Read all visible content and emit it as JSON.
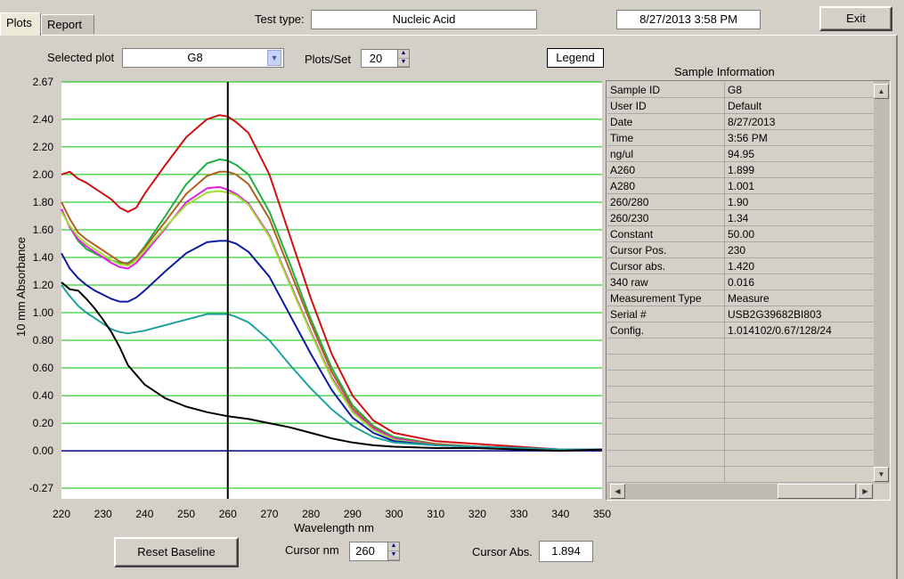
{
  "tabs": {
    "plots": "Plots",
    "report": "Report"
  },
  "header": {
    "test_type_label": "Test type:",
    "test_type_value": "Nucleic Acid",
    "datetime": "8/27/2013  3:58 PM",
    "exit_label": "Exit"
  },
  "controls": {
    "selected_plot_label": "Selected plot",
    "selected_plot_value": "G8",
    "plots_per_set_label": "Plots/Set",
    "plots_per_set_value": "20",
    "legend_label": "Legend",
    "reset_baseline_label": "Reset Baseline",
    "cursor_nm_label": "Cursor nm",
    "cursor_nm_value": "260",
    "cursor_abs_label": "Cursor Abs.",
    "cursor_abs_value": "1.894"
  },
  "sample_info": {
    "title": "Sample Information",
    "rows": [
      [
        "Sample ID",
        "G8"
      ],
      [
        "User ID",
        "Default"
      ],
      [
        "Date",
        "8/27/2013"
      ],
      [
        "Time",
        "3:56 PM"
      ],
      [
        "ng/ul",
        " 94.95"
      ],
      [
        "A260",
        " 1.899"
      ],
      [
        "A280",
        " 1.001"
      ],
      [
        "260/280",
        "  1.90"
      ],
      [
        "260/230",
        "  1.34"
      ],
      [
        "Constant",
        " 50.00"
      ],
      [
        "Cursor Pos.",
        " 230"
      ],
      [
        "Cursor abs.",
        " 1.420"
      ],
      [
        "340 raw",
        " 0.016"
      ],
      [
        "Measurement Type",
        "Measure"
      ],
      [
        "Serial #",
        "USB2G39682BI803"
      ],
      [
        "Config.",
        "1.014102/0.67/128/24"
      ],
      [
        "",
        ""
      ],
      [
        "",
        ""
      ],
      [
        "",
        ""
      ],
      [
        "",
        ""
      ],
      [
        "",
        ""
      ],
      [
        "",
        ""
      ],
      [
        "",
        ""
      ],
      [
        "",
        ""
      ],
      [
        "",
        ""
      ]
    ]
  },
  "chart_data": {
    "type": "line",
    "xlabel": "Wavelength nm",
    "ylabel": "10 mm Absorbance",
    "xlim": [
      220,
      350
    ],
    "ylim": [
      -0.27,
      2.67
    ],
    "x_ticks": [
      "220",
      "230",
      "240",
      "250",
      "260",
      "270",
      "280",
      "290",
      "300",
      "310",
      "320",
      "330",
      "340",
      "350"
    ],
    "y_ticks": [
      "2.67",
      "2.40",
      "2.20",
      "2.00",
      "1.80",
      "1.60",
      "1.40",
      "1.20",
      "1.00",
      "0.80",
      "0.60",
      "0.40",
      "0.20",
      "0.00",
      "-0.27"
    ],
    "cursor_x": 260,
    "grid": true,
    "colors": {
      "grid": "#00c000",
      "baseline": "#000080",
      "cursor": "#000000",
      "plot_bg": "#ffffff"
    },
    "series": [
      {
        "color": "#d01010",
        "x": [
          220,
          222,
          224,
          226,
          228,
          230,
          232,
          234,
          236,
          238,
          240,
          245,
          250,
          255,
          258,
          260,
          262,
          265,
          270,
          275,
          280,
          285,
          290,
          295,
          300,
          310,
          320,
          330,
          340,
          350
        ],
        "y": [
          2.0,
          2.02,
          1.97,
          1.94,
          1.9,
          1.86,
          1.82,
          1.76,
          1.73,
          1.76,
          1.86,
          2.07,
          2.27,
          2.4,
          2.43,
          2.42,
          2.38,
          2.3,
          2.0,
          1.55,
          1.1,
          0.7,
          0.4,
          0.22,
          0.13,
          0.07,
          0.05,
          0.03,
          0.01,
          0.01
        ]
      },
      {
        "color": "#20b040",
        "x": [
          220,
          222,
          224,
          226,
          228,
          230,
          232,
          234,
          236,
          238,
          240,
          245,
          250,
          255,
          258,
          260,
          262,
          265,
          270,
          275,
          280,
          285,
          290,
          295,
          300,
          310,
          320,
          330,
          340,
          350
        ],
        "y": [
          1.75,
          1.62,
          1.52,
          1.46,
          1.43,
          1.4,
          1.38,
          1.36,
          1.36,
          1.4,
          1.48,
          1.7,
          1.93,
          2.08,
          2.11,
          2.1,
          2.07,
          2.0,
          1.73,
          1.35,
          0.95,
          0.6,
          0.33,
          0.18,
          0.1,
          0.05,
          0.03,
          0.02,
          0.01,
          0.01
        ]
      },
      {
        "color": "#b06020",
        "x": [
          220,
          222,
          224,
          226,
          228,
          230,
          232,
          234,
          236,
          238,
          240,
          245,
          250,
          255,
          258,
          260,
          262,
          265,
          270,
          275,
          280,
          285,
          290,
          295,
          300,
          310,
          320,
          330,
          340,
          350
        ],
        "y": [
          1.8,
          1.68,
          1.58,
          1.53,
          1.49,
          1.45,
          1.41,
          1.37,
          1.35,
          1.4,
          1.47,
          1.66,
          1.86,
          1.99,
          2.02,
          2.02,
          2.0,
          1.93,
          1.68,
          1.3,
          0.92,
          0.57,
          0.31,
          0.17,
          0.09,
          0.05,
          0.03,
          0.02,
          0.01,
          0.01
        ]
      },
      {
        "color": "#e020e0",
        "x": [
          220,
          222,
          224,
          226,
          228,
          230,
          232,
          234,
          236,
          238,
          240,
          245,
          250,
          255,
          258,
          260,
          262,
          265,
          270,
          275,
          280,
          285,
          290,
          295,
          300,
          310,
          320,
          330,
          340,
          350
        ],
        "y": [
          1.75,
          1.62,
          1.53,
          1.48,
          1.44,
          1.4,
          1.36,
          1.33,
          1.32,
          1.36,
          1.43,
          1.61,
          1.8,
          1.9,
          1.91,
          1.89,
          1.86,
          1.79,
          1.56,
          1.21,
          0.86,
          0.53,
          0.29,
          0.16,
          0.09,
          0.04,
          0.03,
          0.02,
          0.01,
          0.01
        ]
      },
      {
        "color": "#a0e030",
        "x": [
          220,
          222,
          224,
          226,
          228,
          230,
          232,
          234,
          236,
          238,
          240,
          245,
          250,
          255,
          258,
          260,
          262,
          265,
          270,
          275,
          280,
          285,
          290,
          295,
          300,
          310,
          320,
          330,
          340,
          350
        ],
        "y": [
          1.73,
          1.63,
          1.55,
          1.5,
          1.46,
          1.42,
          1.38,
          1.35,
          1.34,
          1.38,
          1.45,
          1.62,
          1.78,
          1.87,
          1.88,
          1.87,
          1.85,
          1.78,
          1.55,
          1.2,
          0.85,
          0.52,
          0.28,
          0.15,
          0.08,
          0.04,
          0.03,
          0.02,
          0.01,
          0.01
        ]
      },
      {
        "color": "#101ca0",
        "x": [
          220,
          222,
          224,
          226,
          228,
          230,
          232,
          234,
          236,
          238,
          240,
          245,
          250,
          255,
          258,
          260,
          262,
          265,
          270,
          275,
          280,
          285,
          290,
          295,
          300,
          310,
          320,
          330,
          340,
          350
        ],
        "y": [
          1.43,
          1.32,
          1.25,
          1.2,
          1.16,
          1.13,
          1.1,
          1.08,
          1.08,
          1.11,
          1.16,
          1.3,
          1.43,
          1.51,
          1.52,
          1.52,
          1.5,
          1.44,
          1.26,
          0.98,
          0.7,
          0.44,
          0.24,
          0.13,
          0.07,
          0.04,
          0.03,
          0.02,
          0.01,
          0.01
        ]
      },
      {
        "color": "#20a0a0",
        "x": [
          220,
          222,
          224,
          226,
          228,
          230,
          232,
          234,
          236,
          238,
          240,
          245,
          250,
          255,
          258,
          260,
          262,
          265,
          270,
          275,
          280,
          285,
          290,
          295,
          300,
          310,
          320,
          330,
          340,
          350
        ],
        "y": [
          1.2,
          1.12,
          1.05,
          1.0,
          0.96,
          0.92,
          0.88,
          0.86,
          0.85,
          0.86,
          0.87,
          0.91,
          0.95,
          0.99,
          0.99,
          0.99,
          0.97,
          0.93,
          0.8,
          0.62,
          0.45,
          0.3,
          0.18,
          0.1,
          0.06,
          0.04,
          0.03,
          0.02,
          0.01,
          0.01
        ]
      },
      {
        "color": "#000000",
        "x": [
          220,
          222,
          224,
          226,
          228,
          230,
          232,
          234,
          236,
          238,
          240,
          245,
          250,
          255,
          260,
          265,
          270,
          275,
          280,
          285,
          290,
          295,
          300,
          310,
          320,
          330,
          340,
          350
        ],
        "y": [
          1.22,
          1.17,
          1.16,
          1.1,
          1.03,
          0.95,
          0.86,
          0.75,
          0.62,
          0.55,
          0.48,
          0.38,
          0.32,
          0.28,
          0.25,
          0.23,
          0.2,
          0.17,
          0.13,
          0.09,
          0.06,
          0.04,
          0.03,
          0.02,
          0.02,
          0.01,
          0.0,
          0.01
        ]
      }
    ]
  }
}
